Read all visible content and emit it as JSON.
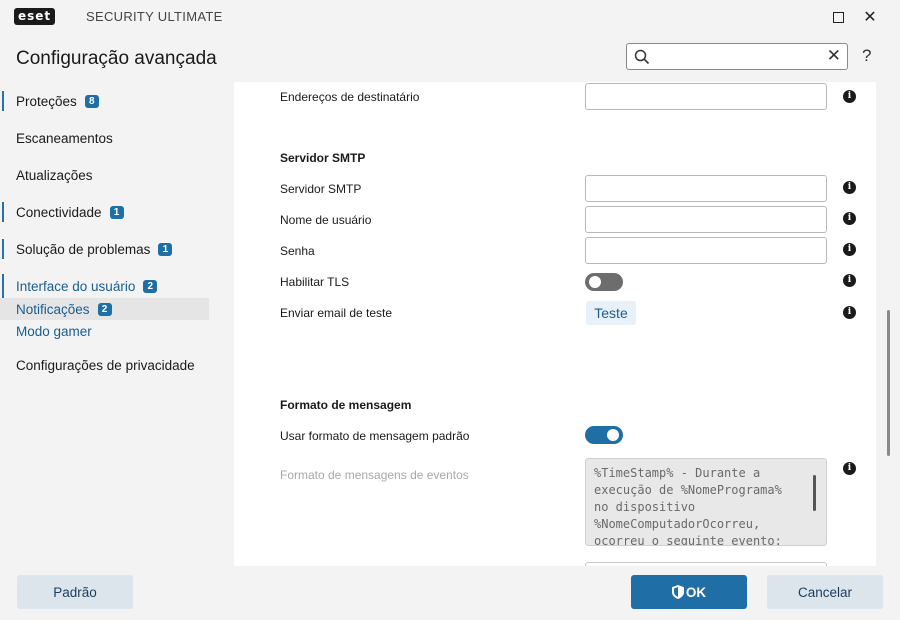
{
  "titlebar": {
    "logo_text": "eset",
    "product": "SECURITY ULTIMATE"
  },
  "header": {
    "title": "Configuração avançada",
    "search_value": "",
    "help_label": "?"
  },
  "sidebar": {
    "items": [
      {
        "label": "Proteções",
        "badge": "8"
      },
      {
        "label": "Escaneamentos"
      },
      {
        "label": "Atualizações"
      },
      {
        "label": "Conectividade",
        "badge": "1"
      },
      {
        "label": "Solução de problemas",
        "badge": "1"
      },
      {
        "label": "Interface do usuário",
        "badge": "2"
      },
      {
        "label": "Notificações",
        "badge": "2",
        "selected": true
      },
      {
        "label": "Modo gamer"
      },
      {
        "label": "Configurações de privacidade"
      }
    ]
  },
  "content": {
    "recipient_label": "Endereços de destinatário",
    "recipient_value": "",
    "smtp_section": "Servidor SMTP",
    "smtp_server_label": "Servidor SMTP",
    "smtp_server_value": "",
    "username_label": "Nome de usuário",
    "username_value": "",
    "password_label": "Senha",
    "password_value": "",
    "tls_label": "Habilitar TLS",
    "tls_enabled": false,
    "test_email_label": "Enviar email de teste",
    "test_button": "Teste",
    "message_format_section": "Formato de mensagem",
    "default_format_label": "Usar formato de mensagem padrão",
    "default_format_enabled": true,
    "event_format_label": "Formato de mensagens de eventos",
    "event_format_lines": [
      "%TimeStamp% - Durante a",
      "execução de %NomePrograma%",
      "no dispositivo",
      "%NomeComputadorOcorreu,",
      "ocorreu o seguinte evento:"
    ]
  },
  "footer": {
    "default_button": "Padrão",
    "ok_button": "OK",
    "cancel_button": "Cancelar"
  },
  "colors": {
    "accent": "#1f6fa6",
    "badge": "#1f6fa6",
    "window_bg": "#f3f3f3",
    "content_bg": "#ffffff"
  }
}
